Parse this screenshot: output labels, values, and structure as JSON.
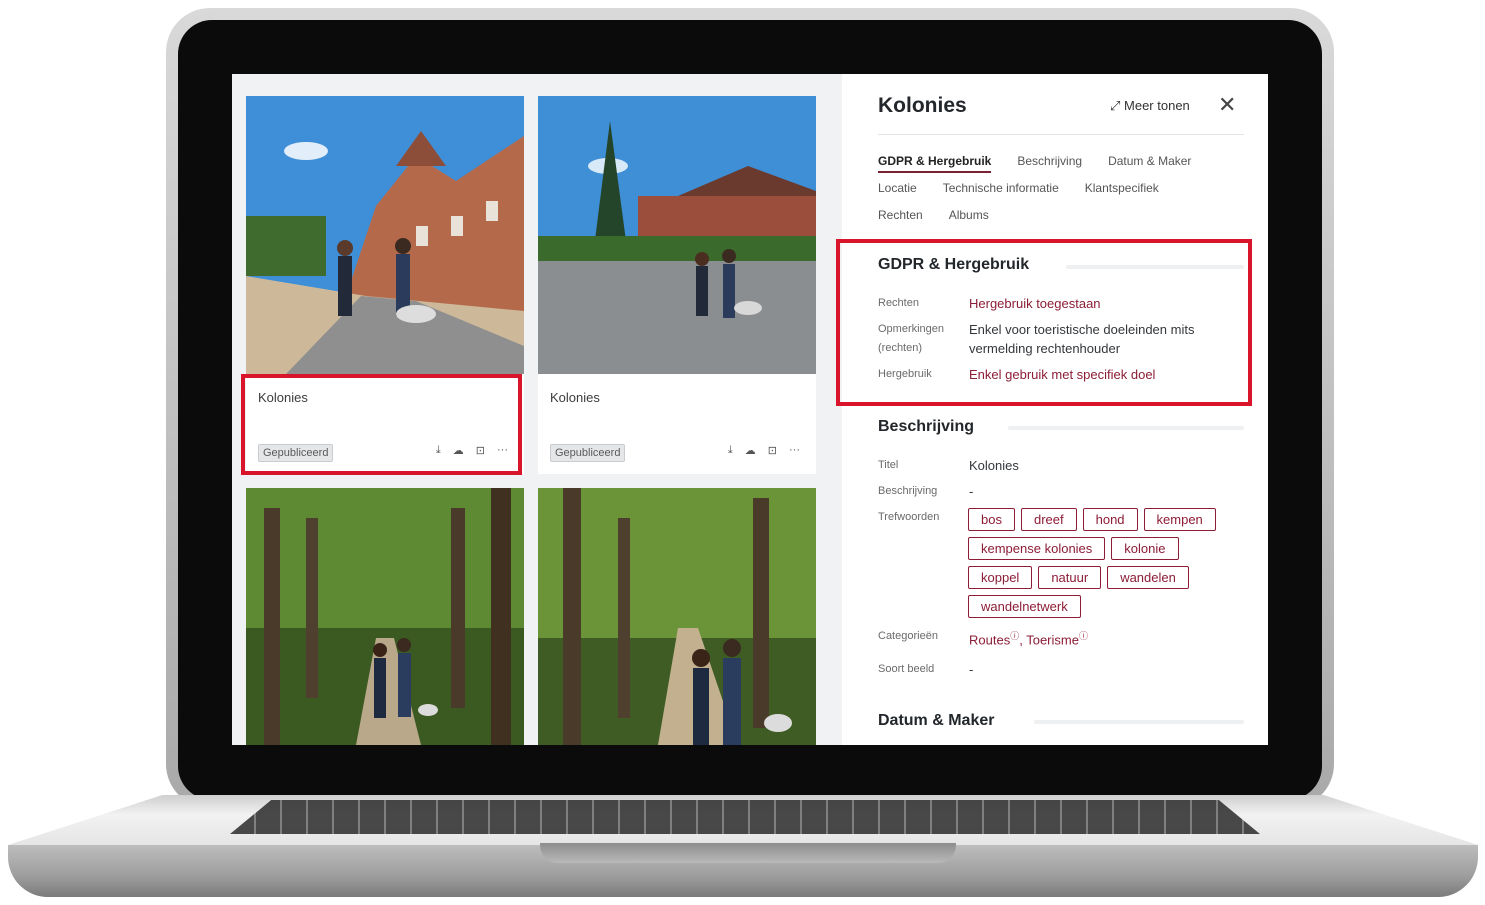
{
  "cards": [
    {
      "title": "Kolonies",
      "status": "Gepubliceerd"
    },
    {
      "title": "Kolonies",
      "status": "Gepubliceerd"
    }
  ],
  "card_actions": {
    "download": "⤓",
    "upload": "☁",
    "preview": "⊡",
    "more": "···"
  },
  "panel": {
    "title": "Kolonies",
    "meer_tonen": "Meer tonen",
    "close": "✕",
    "tabs_row1": [
      "GDPR & Hergebruik",
      "Beschrijving",
      "Datum & Maker"
    ],
    "tabs_row2": [
      "Locatie",
      "Technische informatie",
      "Klantspecifiek"
    ],
    "tabs_row3": [
      "Rechten",
      "Albums"
    ],
    "gdpr": {
      "heading": "GDPR & Hergebruik",
      "rechten_label": "Rechten",
      "rechten_value": "Hergebruik toegestaan",
      "opmerkingen_label_1": "Opmerkingen",
      "opmerkingen_label_2": "(rechten)",
      "opmerkingen_value_1": "Enkel voor toeristische doeleinden mits",
      "opmerkingen_value_2": "vermelding rechtenhouder",
      "hergebruik_label": "Hergebruik",
      "hergebruik_value": "Enkel gebruik met specifiek doel"
    },
    "beschrijving": {
      "heading": "Beschrijving",
      "titel_label": "Titel",
      "titel_value": "Kolonies",
      "beschrijving_label": "Beschrijving",
      "beschrijving_value": "-",
      "trefwoorden_label": "Trefwoorden",
      "tags": [
        "bos",
        "dreef",
        "hond",
        "kempen",
        "kempense kolonies",
        "kolonie",
        "koppel",
        "natuur",
        "wandelen",
        "wandelnetwerk"
      ],
      "categorieen_label": "Categorieën",
      "cat1": "Routes",
      "cat_sep": ", ",
      "cat2": "Toerisme",
      "soort_label": "Soort beeld",
      "soort_value": "-"
    },
    "datum_heading": "Datum & Maker"
  },
  "colors": {
    "accent": "#8c1d36",
    "highlight": "#d9152c"
  }
}
